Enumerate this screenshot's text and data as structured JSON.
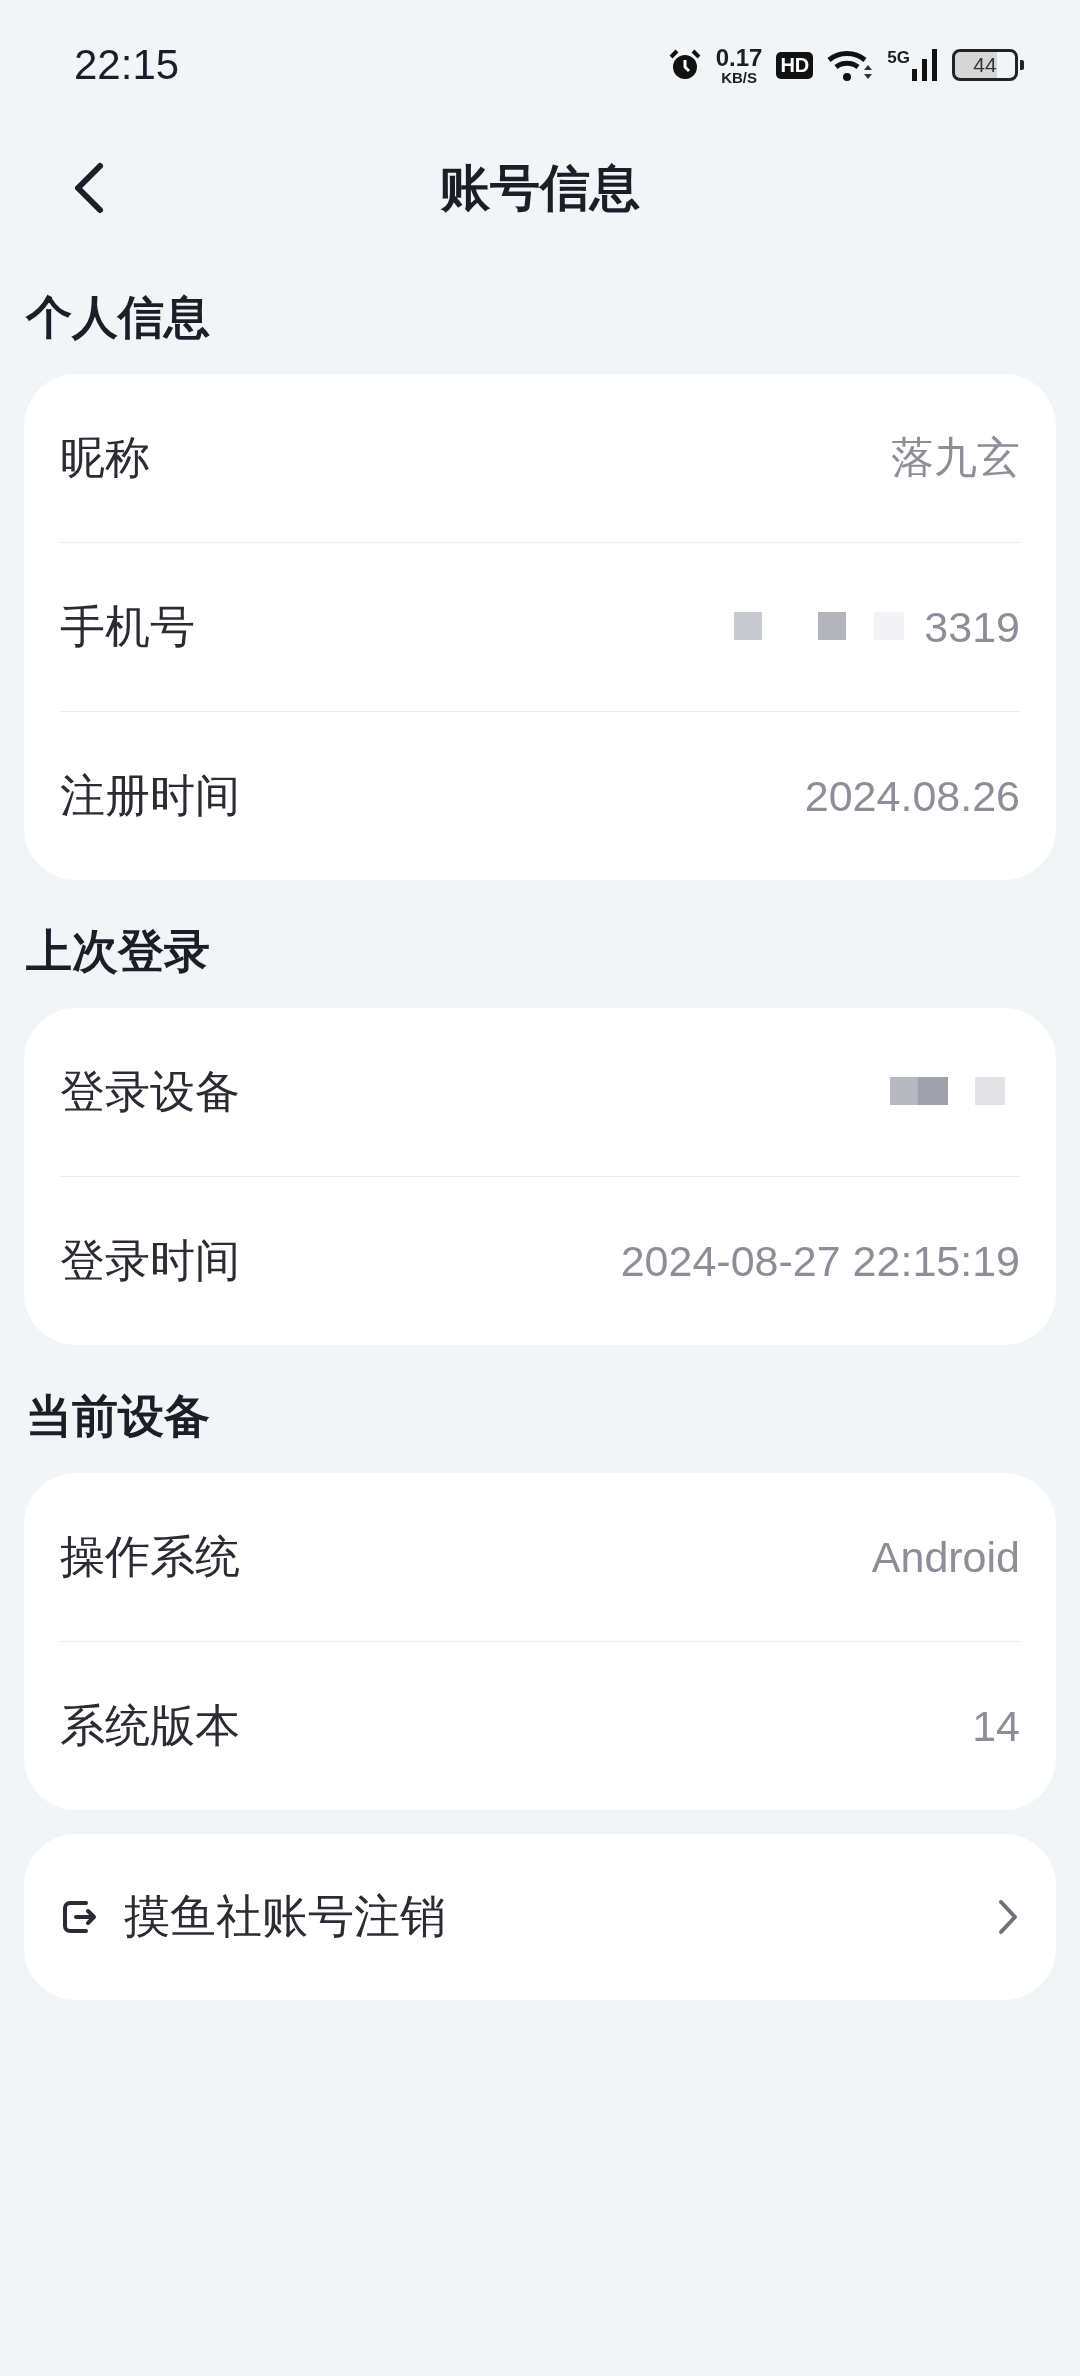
{
  "status_bar": {
    "time": "22:15",
    "net_speed": "0.17",
    "net_unit": "KB/S",
    "hd": "HD",
    "network": "5G",
    "battery": "44"
  },
  "header": {
    "title": "账号信息"
  },
  "sections": [
    {
      "title": "个人信息",
      "rows": [
        {
          "label": "昵称",
          "value": "落九玄",
          "redacted": false
        },
        {
          "label": "手机号",
          "value": "3319",
          "redacted": true
        },
        {
          "label": "注册时间",
          "value": "2024.08.26",
          "redacted": false
        }
      ]
    },
    {
      "title": "上次登录",
      "rows": [
        {
          "label": "登录设备",
          "redacted": true
        },
        {
          "label": "登录时间",
          "value": "2024-08-27 22:15:19",
          "redacted": false
        }
      ]
    },
    {
      "title": "当前设备",
      "rows": [
        {
          "label": "操作系统",
          "value": "Android",
          "redacted": false
        },
        {
          "label": "系统版本",
          "value": "14",
          "redacted": false
        }
      ]
    }
  ],
  "action": {
    "label": "摸鱼社账号注销"
  }
}
